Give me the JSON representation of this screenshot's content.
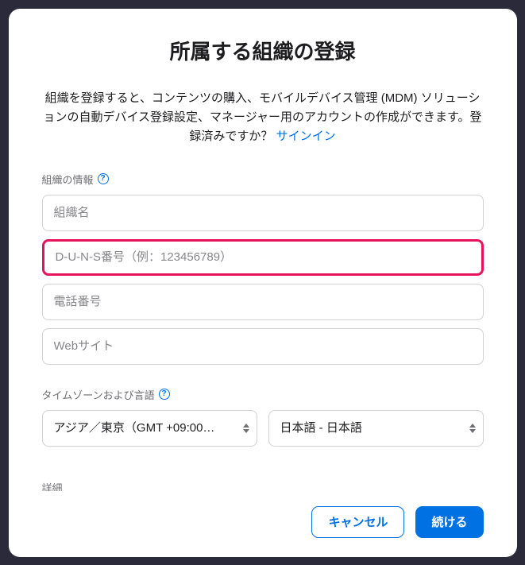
{
  "modal": {
    "title": "所属する組織の登録",
    "description_part1": "組織を登録すると、コンテンツの購入、モバイルデバイス管理 (MDM) ソリューションの自動デバイス登録設定、マネージャー用のアカウントの作成ができます。登録済みですか？ ",
    "signin_link": "サインイン"
  },
  "section_org_info": {
    "label": "組織の情報",
    "org_name_placeholder": "組織名",
    "duns_placeholder": "D-U-N-S番号（例：123456789）",
    "phone_placeholder": "電話番号",
    "website_placeholder": "Webサイト"
  },
  "section_timezone": {
    "label": "タイムゾーンおよび言語",
    "timezone_value": "アジア／東京（GMT +09:00…",
    "language_value": "日本語 - 日本語"
  },
  "section_details": {
    "label": "詳細"
  },
  "footer": {
    "cancel_label": "キャンセル",
    "continue_label": "続ける"
  }
}
